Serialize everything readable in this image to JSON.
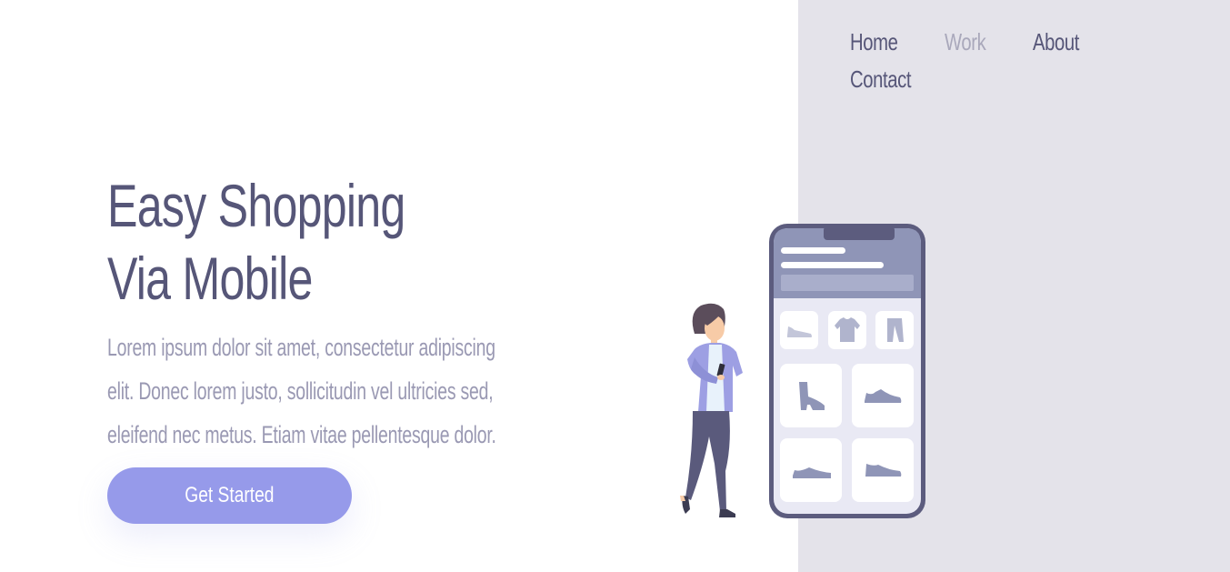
{
  "nav": {
    "items": [
      {
        "label": "Home",
        "active": false
      },
      {
        "label": "Work",
        "active": true
      },
      {
        "label": "About",
        "active": false
      },
      {
        "label": "Contact",
        "active": false
      }
    ]
  },
  "hero": {
    "title_lines": [
      "Easy Shopping",
      "Via Mobile"
    ],
    "description_lines": [
      "Lorem ipsum dolor sit amet, consectetur adipiscing",
      "elit. Donec lorem justo, sollicitudin vel ultricies sed,",
      "eleifend nec metus. Etiam vitae pellentesque dolor."
    ],
    "cta_label": "Get Started"
  },
  "illustration": {
    "product_icons": [
      "flat-shoe-icon",
      "t-shirt-icon",
      "pants-icon",
      "boot-icon",
      "sneaker-icon",
      "sneaker-icon",
      "sneaker-icon"
    ]
  },
  "colors": {
    "primary_text": "#565678",
    "muted_text": "#9a99b3",
    "nav_dim": "#a9a8bb",
    "button": "#969aea",
    "panel": "#e4e3ea"
  }
}
